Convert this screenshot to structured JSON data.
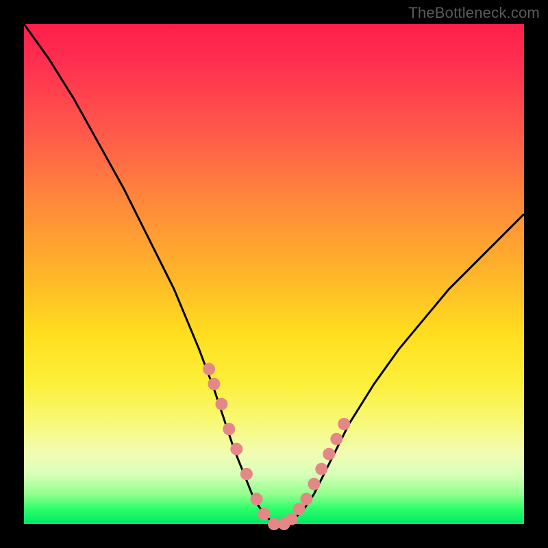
{
  "watermark": "TheBottleneck.com",
  "colors": {
    "background": "#000000",
    "curve_stroke": "#000000",
    "marker_fill": "#e48787",
    "gradient_top": "#ff1f4a",
    "gradient_mid1": "#ff8a3a",
    "gradient_mid2": "#ffde1e",
    "gradient_bottom": "#00e865"
  },
  "chart_data": {
    "type": "line",
    "title": "",
    "xlabel": "",
    "ylabel": "",
    "xlim": [
      0,
      100
    ],
    "ylim": [
      0,
      100
    ],
    "series": [
      {
        "name": "bottleneck-curve",
        "x": [
          0,
          5,
          10,
          15,
          20,
          25,
          30,
          35,
          38,
          40,
          42,
          44,
          46,
          48,
          50,
          52,
          54,
          56,
          58,
          60,
          62,
          65,
          70,
          75,
          80,
          85,
          90,
          95,
          100
        ],
        "values": [
          100,
          93,
          85,
          76,
          67,
          57,
          47,
          35,
          27,
          21,
          15,
          10,
          5,
          2,
          0,
          0,
          1,
          3,
          6,
          10,
          14,
          20,
          28,
          35,
          41,
          47,
          52,
          57,
          62
        ]
      }
    ],
    "markers": {
      "name": "highlighted-points",
      "x": [
        37,
        38,
        39.5,
        41,
        42.5,
        44.5,
        46.5,
        48,
        50,
        52,
        53.5,
        55,
        56.5,
        58,
        59.5,
        61,
        62.5,
        64
      ],
      "values": [
        31,
        28,
        24,
        19,
        15,
        10,
        5,
        2,
        0,
        0,
        1,
        3,
        5,
        8,
        11,
        14,
        17,
        20
      ]
    }
  }
}
